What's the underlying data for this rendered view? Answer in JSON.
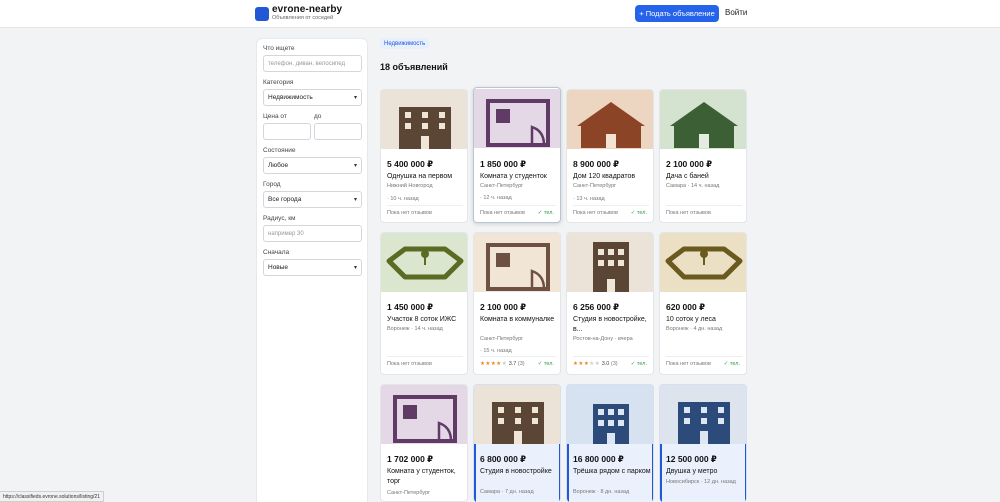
{
  "header": {
    "brand": "evrone-nearby",
    "tagline": "Объявления от соседей",
    "post_button": "+ Подать объявление",
    "login": "Войти"
  },
  "filters": {
    "query_label": "Что ищете",
    "query_placeholder": "телефон, диван, велосипед",
    "category_label": "Категория",
    "category_value": "Недвижимость",
    "price_from_label": "Цена от",
    "price_to_label": "до",
    "condition_label": "Состояние",
    "condition_value": "Любое",
    "city_label": "Город",
    "city_value": "Все города",
    "radius_label": "Радиус, км",
    "radius_placeholder": "например 30",
    "sort_label": "Сначала",
    "sort_value": "Новые"
  },
  "main": {
    "active_category": "Недвижимость",
    "count": "18 объявлений"
  },
  "colors": {
    "accent": "#2563eb",
    "brown_building": "#5b4636",
    "navy_building": "#2c4a7a",
    "green_plot": "#5a6b24",
    "purple_room": "#5f3b66",
    "rating_star": "#e58a1f",
    "phone_ok": "#2a9d45"
  },
  "listings": [
    {
      "price": "5 400 000 ₽",
      "title": "Однушка на первом",
      "city": "Нижний Новгород",
      "ago": "· 10 ч. назад",
      "reviews": "Пока нет отзывов",
      "phone": "",
      "icon": "apartment-building-icon"
    },
    {
      "price": "1 850 000 ₽",
      "title": "Комната у студенток",
      "city": "Санкт-Петербург",
      "ago": "· 12 ч. назад",
      "reviews": "Пока нет отзывов",
      "phone": "✓ тел.",
      "icon": "room-plan-icon"
    },
    {
      "price": "8 900 000 ₽",
      "title": "Дом 120 квадратов",
      "city": "Санкт-Петербург",
      "ago": "· 13 ч. назад",
      "reviews": "Пока нет отзывов",
      "phone": "✓ тел.",
      "icon": "house-icon"
    },
    {
      "price": "2 100 000 ₽",
      "title": "Дача с баней",
      "city": "Самара",
      "ago": "· 14 ч. назад",
      "reviews": "Пока нет отзывов",
      "phone": "",
      "icon": "house-icon"
    },
    {
      "price": "1 450 000 ₽",
      "title": "Участок 8 соток ИЖС",
      "city": "Воронеж",
      "ago": "· 14 ч. назад",
      "reviews": "Пока нет отзывов",
      "phone": "",
      "icon": "land-plot-icon"
    },
    {
      "price": "2 100 000 ₽",
      "title": "Комната в коммуналке",
      "city": "Санкт-Петербург",
      "ago": "· 15 ч. назад",
      "rating": 3.7,
      "rating_text": "3.7",
      "reviews_count": "(3)",
      "phone": "✓ тел.",
      "icon": "room-plan-icon"
    },
    {
      "price": "6 256 000 ₽",
      "title": "Студия в новостройке, в...",
      "city": "Ростов-на-Дону",
      "ago": "· вчера",
      "rating": 3.0,
      "rating_text": "3.0",
      "reviews_count": "(3)",
      "phone": "✓ тел.",
      "icon": "apartment-building-icon"
    },
    {
      "price": "620 000 ₽",
      "title": "10 соток у леса",
      "city": "Воронеж",
      "ago": "· 4 дн. назад",
      "reviews": "Пока нет отзывов",
      "phone": "✓ тел.",
      "icon": "land-plot-icon"
    },
    {
      "price": "1 702 000 ₽",
      "title": "Комната у студенток, торг",
      "city": "Санкт-Петербург",
      "ago": "",
      "icon": "room-plan-icon"
    },
    {
      "price": "6 800 000 ₽",
      "title": "Студия в новостройке",
      "city": "Самара",
      "ago": "· 7 дн. назад",
      "icon": "apartment-building-icon"
    },
    {
      "price": "16 800 000 ₽",
      "title": "Трёшка рядом с парком",
      "city": "Воронеж",
      "ago": "· 8 дн. назад",
      "icon": "apartment-building-icon"
    },
    {
      "price": "12 500 000 ₽",
      "title": "Двушка у метро",
      "city": "Новосибирск",
      "ago": "· 12 дн. назад",
      "icon": "apartment-building-icon"
    }
  ],
  "status_url": "https://classifieds.evrone.solutions/listing/21"
}
